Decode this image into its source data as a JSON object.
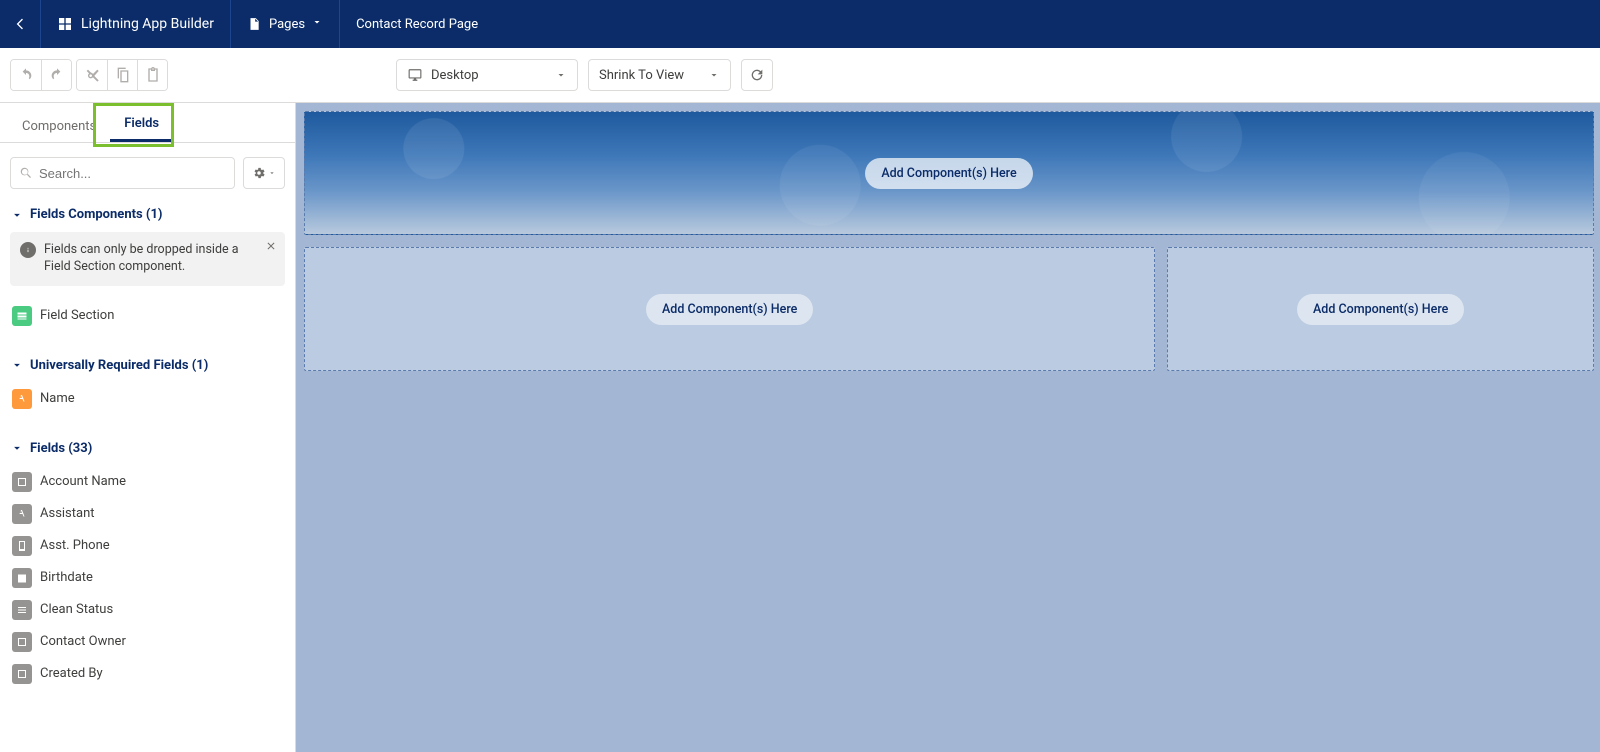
{
  "topnav": {
    "app_title": "Lightning App Builder",
    "pages_label": "Pages",
    "page_name": "Contact Record Page"
  },
  "toolbar": {
    "device_select": "Desktop",
    "zoom_select": "Shrink To View"
  },
  "sidebar": {
    "tab_components": "Components",
    "tab_fields": "Fields",
    "search_placeholder": "Search...",
    "section_fields_components": "Fields Components (1)",
    "info_text": "Fields can only be dropped inside a Field Section component.",
    "field_section_label": "Field Section",
    "section_required": "Universally Required Fields (1)",
    "name_field": "Name",
    "section_fields": "Fields (33)",
    "fields_list": {
      "f0": "Account Name",
      "f1": "Assistant",
      "f2": "Asst. Phone",
      "f3": "Birthdate",
      "f4": "Clean Status",
      "f5": "Contact Owner",
      "f6": "Created By"
    }
  },
  "canvas": {
    "add_here": "Add Component(s) Here"
  }
}
